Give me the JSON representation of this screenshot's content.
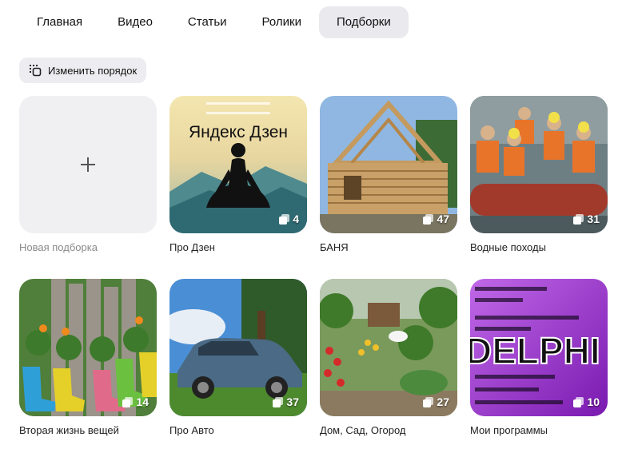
{
  "tabs": [
    {
      "label": "Главная"
    },
    {
      "label": "Видео"
    },
    {
      "label": "Статьи"
    },
    {
      "label": "Ролики"
    },
    {
      "label": "Подборки",
      "active": true
    }
  ],
  "reorder_label": "Изменить порядок",
  "new_collection": {
    "label": "Новая подборка"
  },
  "collections": [
    {
      "title": "Про Дзен",
      "count": "4",
      "cover_text": "Яндекс Дзен",
      "icon": "meditation-cover"
    },
    {
      "title": "БАНЯ",
      "count": "47",
      "icon": "log-house-cover"
    },
    {
      "title": "Водные походы",
      "count": "31",
      "icon": "rafting-cover"
    },
    {
      "title": "Вторая жизнь вещей",
      "count": "14",
      "icon": "rubber-boots-planters-cover"
    },
    {
      "title": "Про Авто",
      "count": "37",
      "icon": "car-cover"
    },
    {
      "title": "Дом, Сад, Огород",
      "count": "27",
      "icon": "garden-cover"
    },
    {
      "title": "Мои программы",
      "count": "10",
      "cover_text": "DELPHI",
      "icon": "delphi-code-cover"
    }
  ],
  "colors": {
    "tab_active_bg": "#e9e9ee",
    "button_bg": "#ededf1",
    "new_card_bg": "#f0f0f3",
    "delphi_purple": "#a02fd0"
  }
}
